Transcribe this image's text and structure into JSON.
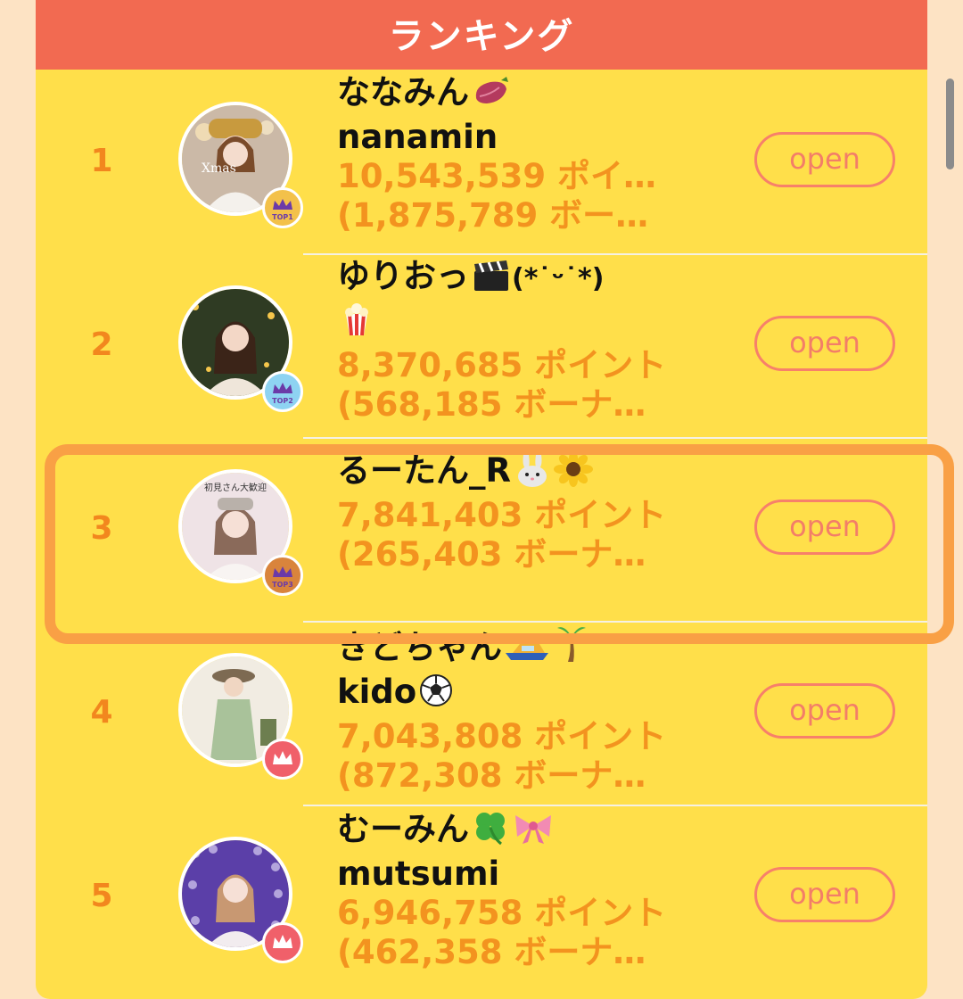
{
  "header": {
    "title": "ランキング"
  },
  "colors": {
    "header": "#f26a51",
    "panel": "#ffdf4a",
    "points_text": "#f3931f",
    "open_button": "#f7806a",
    "highlight": "#f9a045"
  },
  "button_label": "open",
  "rows": [
    {
      "rank": "1",
      "name": "ななみん",
      "name_emoji": [
        "sweet-potato-icon"
      ],
      "sub": "nanamin",
      "points": "10,543,539 ポイ…",
      "bonus": "(1,875,789 ボー…",
      "badge": "TOP1",
      "badge_icon": "crown-icon",
      "avatar_text": "Xmas"
    },
    {
      "rank": "2",
      "name": "ゆりおっ",
      "name_suffix": "(*˙ᵕ˙*)",
      "name_emoji": [
        "clapper-board-icon"
      ],
      "sub_emoji": [
        "popcorn-icon"
      ],
      "points": "8,370,685 ポイント",
      "bonus": "(568,185 ボーナ…",
      "badge": "TOP2",
      "badge_icon": "crown-icon"
    },
    {
      "rank": "3",
      "name": "るーたん_R",
      "name_emoji": [
        "rabbit-face-icon",
        "sunflower-icon"
      ],
      "points": "7,841,403 ポイント",
      "bonus": "(265,403 ボーナ…",
      "badge": "TOP3",
      "badge_icon": "crown-icon",
      "avatar_text": "初見さん大歓迎"
    },
    {
      "rank": "4",
      "name": "きどちゃん",
      "name_emoji": [
        "speedboat-icon",
        "palm-tree-icon"
      ],
      "sub": "kido",
      "sub_emoji": [
        "soccer-ball-icon"
      ],
      "points": "7,043,808 ポイント",
      "bonus": "(872,308 ボーナ…",
      "badge_icon": "crown-icon"
    },
    {
      "rank": "5",
      "name": "むーみん",
      "name_emoji": [
        "four-leaf-clover-icon",
        "ribbon-icon"
      ],
      "sub": "mutsumi",
      "points": "6,946,758 ポイント",
      "bonus": "(462,358 ボーナ…",
      "badge_icon": "crown-icon"
    }
  ]
}
